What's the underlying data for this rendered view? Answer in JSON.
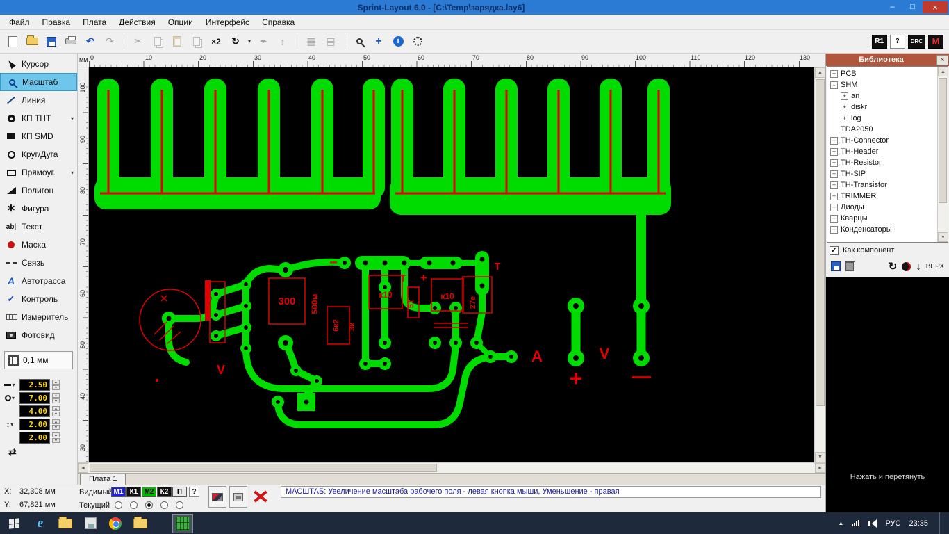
{
  "window": {
    "title": "Sprint-Layout 6.0 - [C:\\Temp\\зарядка.lay6]"
  },
  "icons": {
    "minimize": "–",
    "maximize": "□",
    "close": "×",
    "caret": "▾",
    "undo": "↶",
    "redo": "↷",
    "cut": "✂",
    "x2": "×2",
    "rotate": "↻",
    "fliph": "◂▸",
    "flipv": "↕",
    "grid1": "▦",
    "grid2": "▤",
    "plus_blue": "+",
    "info_i": "i",
    "auto_a": "A",
    "text_tool": "ab|",
    "star": "∗",
    "check": "✓",
    "swap": "⇄",
    "refresh": "↻",
    "up": "▲",
    "down": "▼",
    "left": "◄",
    "right": "►",
    "download": "↓",
    "tray_up": "▲",
    "ie": "e"
  },
  "menu": {
    "items": [
      "Файл",
      "Правка",
      "Плата",
      "Действия",
      "Опции",
      "Интерфейс",
      "Справка"
    ]
  },
  "toolbar": {
    "r1": "R1",
    "help": "?",
    "drc": "DRC",
    "m": "M"
  },
  "tools": {
    "selected": "Масштаб",
    "items": [
      {
        "label": "Курсор"
      },
      {
        "label": "Масштаб"
      },
      {
        "label": "Линия"
      },
      {
        "label": "КП THT"
      },
      {
        "label": "КП SMD"
      },
      {
        "label": "Круг/Дуга"
      },
      {
        "label": "Прямоуг."
      },
      {
        "label": "Полигон"
      },
      {
        "label": "Фигура"
      },
      {
        "label": "Текст"
      },
      {
        "label": "Маска"
      },
      {
        "label": "Связь"
      },
      {
        "label": "Автотрасса"
      },
      {
        "label": "Контроль"
      },
      {
        "label": "Измеритель"
      },
      {
        "label": "Фотовид"
      }
    ]
  },
  "grid": {
    "label": "0,1 мм"
  },
  "params": {
    "p1": "2.50",
    "p2": "7.00",
    "p3": "4.00",
    "p4": "2.00",
    "p5": "2.00"
  },
  "rulers": {
    "unit": "мм",
    "top": [
      "0",
      "10",
      "20",
      "30",
      "40",
      "50",
      "60",
      "70",
      "80",
      "90",
      "100",
      "110",
      "120",
      "130"
    ],
    "left": [
      "100",
      "90",
      "80",
      "70",
      "60",
      "50",
      "40",
      "30"
    ]
  },
  "library": {
    "title": "Библиотека",
    "tree": [
      {
        "label": "PCB",
        "toggle": "+"
      },
      {
        "label": "SHM",
        "toggle": "-"
      },
      {
        "label": "an",
        "toggle": "+"
      },
      {
        "label": "diskr",
        "toggle": "+"
      },
      {
        "label": "log",
        "toggle": "+"
      },
      {
        "label": "TDA2050",
        "toggle": ""
      },
      {
        "label": "TH-Connector",
        "toggle": "+"
      },
      {
        "label": "TH-Header",
        "toggle": "+"
      },
      {
        "label": "TH-Resistor",
        "toggle": "+"
      },
      {
        "label": "TH-SIP",
        "toggle": "+"
      },
      {
        "label": "TH-Transistor",
        "toggle": "+"
      },
      {
        "label": "TRIMMER",
        "toggle": "+"
      },
      {
        "label": "Диоды",
        "toggle": "+"
      },
      {
        "label": "Кварцы",
        "toggle": "+"
      },
      {
        "label": "Конденсаторы",
        "toggle": "+"
      }
    ],
    "as_component": "Как компонент",
    "top_label": "ВЕРХ",
    "hint": "Нажать и перетянуть"
  },
  "status": {
    "tab": "Плата 1",
    "x_label": "X:",
    "x_value": "32,308 мм",
    "y_label": "Y:",
    "y_value": "67,821 мм",
    "visible": "Видимый",
    "current": "Текущий",
    "layers": [
      {
        "label": "М1"
      },
      {
        "label": "К1"
      },
      {
        "label": "М2"
      },
      {
        "label": "К2"
      },
      {
        "label": "П"
      }
    ],
    "help": "?",
    "message": "МАСШТАБ:  Увеличение масштаба рабочего поля - левая кнопка мыши, Уменьшение - правая"
  },
  "taskbar": {
    "lang": "РУС",
    "time": "23:35"
  },
  "pcb": {
    "labels": {
      "r300": "300",
      "c500": "500м",
      "r6k2": "6к2",
      "r3k": "3к",
      "k10a": "к10",
      "r51": "51",
      "k10b": "к10",
      "c27": "27е",
      "minus_small": "−",
      "t1": "Т",
      "plus_small": "+",
      "t2": "Т",
      "ammeter": "A",
      "voltmeter": "V",
      "plus_big": "+",
      "minus_big": "—",
      "v_mark": "V"
    }
  }
}
